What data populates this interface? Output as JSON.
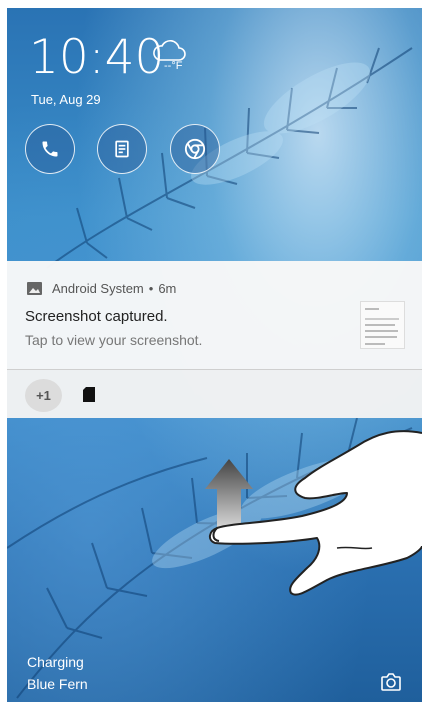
{
  "lockscreen": {
    "time": "10:40",
    "temperature": "--°F",
    "date": "Tue, Aug 29",
    "shortcuts": [
      {
        "name": "phone-icon"
      },
      {
        "name": "memo-icon"
      },
      {
        "name": "chrome-icon"
      }
    ]
  },
  "notification": {
    "app_name": "Android System",
    "separator": "•",
    "age": "6m",
    "title": "Screenshot captured.",
    "text": "Tap to view your screenshot.",
    "more_count": "+1"
  },
  "footer": {
    "charging": "Charging",
    "wallpaper_name": "Blue Fern"
  },
  "colors": {
    "accent_notification_bg": "#f8f8f8",
    "wallpaper_blue": "#2f78b8"
  }
}
